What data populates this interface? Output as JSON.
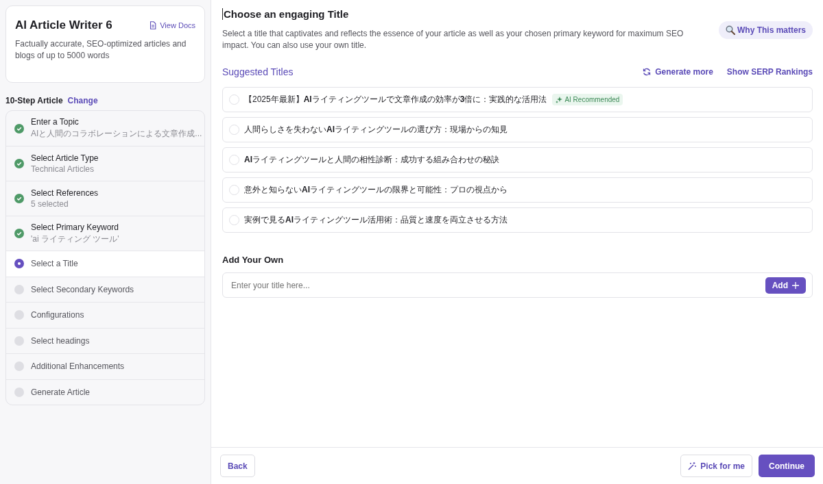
{
  "sidebar": {
    "app": {
      "title": "AI Article Writer 6",
      "docs_link": "View Docs",
      "description": "Factually accurate, SEO-optimized articles and blogs of up to 5000 words"
    },
    "plan": {
      "label": "10-Step Article",
      "change_link": "Change"
    },
    "steps": [
      {
        "label": "Enter a Topic",
        "detail": "AIと人間のコラボレーションによる文章作成...",
        "kind": "done"
      },
      {
        "label": "Select Article Type",
        "detail": "Technical Articles",
        "kind": "done"
      },
      {
        "label": "Select References",
        "detail": "5 selected",
        "kind": "done"
      },
      {
        "label": "Select Primary Keyword",
        "detail": "'ai ライティング ツール'",
        "kind": "done"
      },
      {
        "label": "Select a Title",
        "kind": "current"
      },
      {
        "label": "Select Secondary Keywords",
        "kind": "pending"
      },
      {
        "label": "Configurations",
        "kind": "pending"
      },
      {
        "label": "Select headings",
        "kind": "pending"
      },
      {
        "label": "Additional Enhancements",
        "kind": "pending"
      },
      {
        "label": "Generate Article",
        "kind": "pending"
      }
    ]
  },
  "main": {
    "heading": "Choose an engaging Title",
    "description": "Select a title that captivates and reflects the essence of your article as well as your chosen primary keyword for maximum SEO impact. You can also use your own title.",
    "why_button": "Why This matters",
    "suggested": {
      "label": "Suggested Titles",
      "generate_more": "Generate more",
      "serp_link": "Show SERP Rankings",
      "titles": [
        {
          "text": "【2025年最新】**AI**ライティングツールで文章作成の効率が**3**倍に：実践的な活用法",
          "badge": "AI Recommended",
          "selected": false
        },
        {
          "text": "人間らしさを失わない**AI**ライティングツールの選び方：現場からの知見",
          "selected": false
        },
        {
          "text": "**AI**ライティングツールと人間の相性診断：成功する組み合わせの秘訣",
          "selected": false
        },
        {
          "text": "意外と知らない**AI**ライティングツールの限界と可能性：プロの視点から",
          "selected": false
        },
        {
          "text": "実例で見る**AI**ライティングツール活用術：品質と速度を両立させる方法",
          "selected": false
        }
      ]
    },
    "own": {
      "label": "Add Your Own",
      "placeholder": "Enter your title here...",
      "add_button": "Add"
    }
  },
  "footer": {
    "back": "Back",
    "pick": "Pick for me",
    "continue": "Continue"
  }
}
